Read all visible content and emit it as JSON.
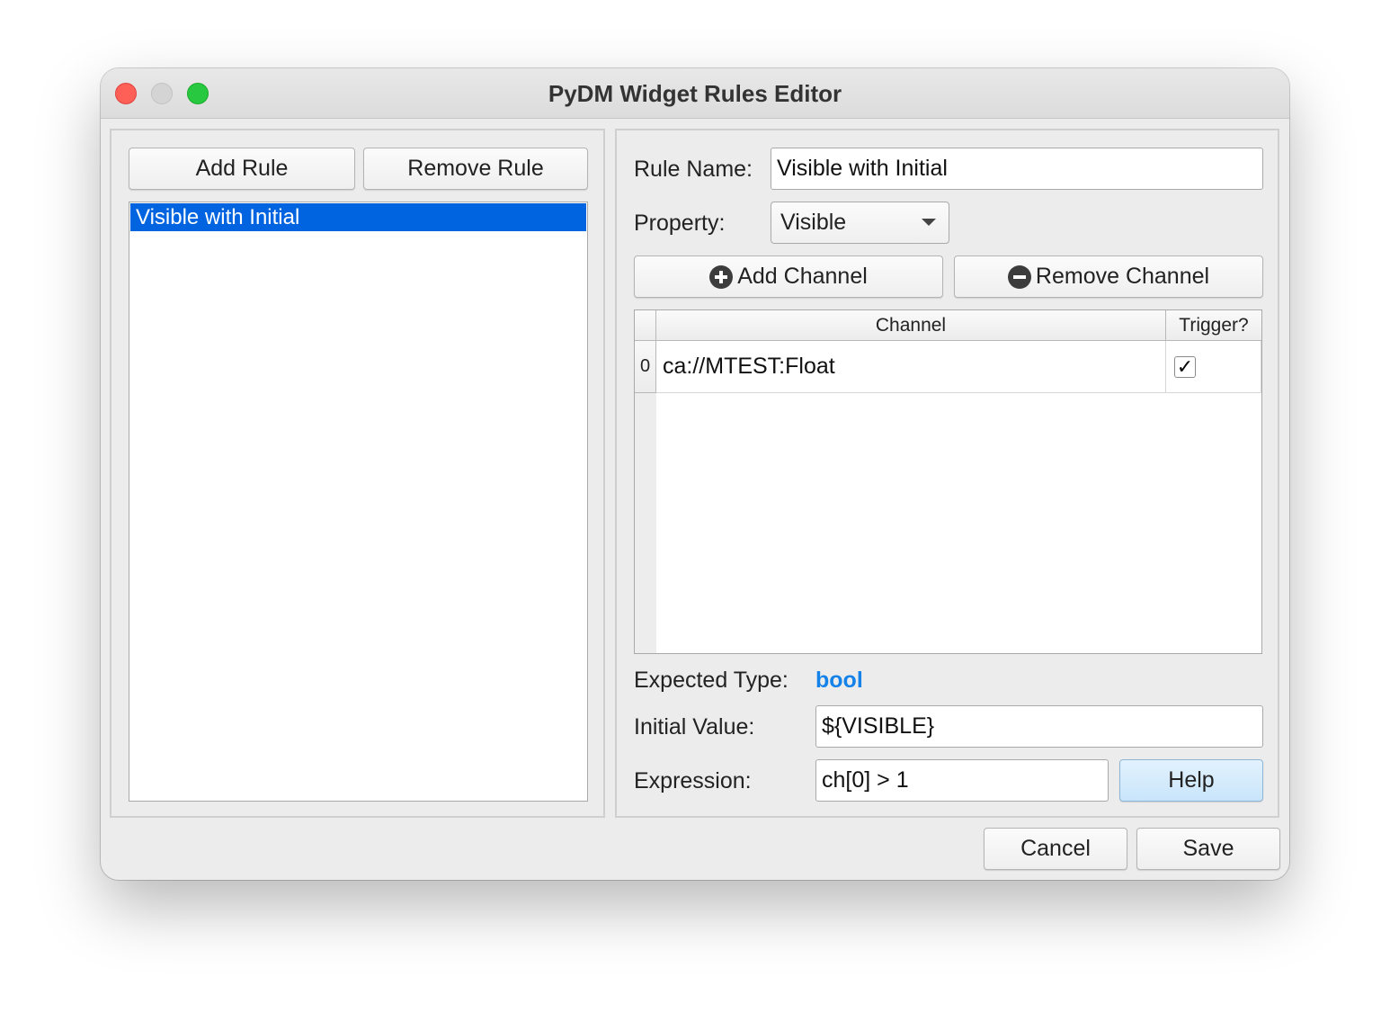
{
  "window": {
    "title": "PyDM Widget Rules Editor"
  },
  "rules_panel": {
    "add_rule_label": "Add Rule",
    "remove_rule_label": "Remove Rule",
    "rules": [
      "Visible with Initial"
    ],
    "selected_rule": "Visible with Initial"
  },
  "rule_editor": {
    "rule_name_label": "Rule Name:",
    "rule_name_value": "Visible with Initial",
    "property_label": "Property:",
    "property_value": "Visible",
    "add_channel_label": "Add Channel",
    "remove_channel_label": "Remove Channel",
    "table": {
      "columns": [
        "Channel",
        "Trigger?"
      ],
      "rows": [
        {
          "index": "0",
          "channel": "ca://MTEST:Float",
          "trigger": "✓",
          "trigger_checked": true
        }
      ]
    },
    "expected_type_label": "Expected Type:",
    "expected_type_value": "bool",
    "initial_value_label": "Initial Value:",
    "initial_value": "${VISIBLE}",
    "expression_label": "Expression:",
    "expression_value": "ch[0] > 1",
    "help_label": "Help"
  },
  "footer": {
    "cancel_label": "Cancel",
    "save_label": "Save"
  },
  "colors": {
    "selection": "#0064e1",
    "accent_type": "#1482e8",
    "close": "#fe5f57",
    "minimize": "#d4d4d4",
    "maximize": "#28c840"
  },
  "icons": {
    "add_channel": "plus-circle-icon",
    "remove_channel": "minus-circle-icon",
    "property_dropdown": "chevron-down-icon"
  }
}
